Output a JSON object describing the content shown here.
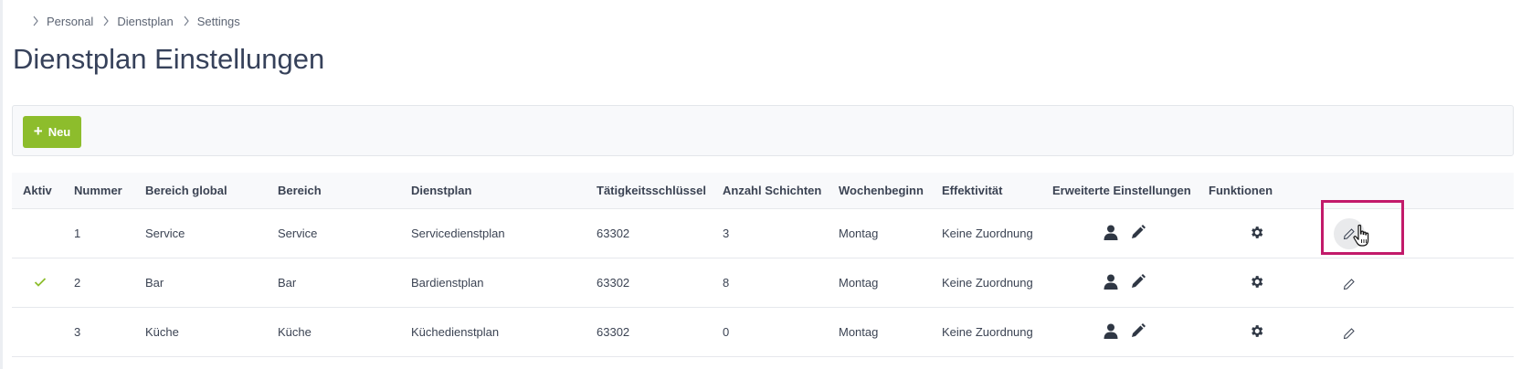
{
  "breadcrumb": [
    "Personal",
    "Dienstplan",
    "Settings"
  ],
  "page": {
    "title": "Dienstplan Einstellungen"
  },
  "toolbar": {
    "new_label": "Neu"
  },
  "table": {
    "columns": [
      "Aktiv",
      "Nummer",
      "Bereich global",
      "Bereich",
      "Dienstplan",
      "Tätigkeitsschlüssel",
      "Anzahl Schichten",
      "Wochenbeginn",
      "Effektivität",
      "Erweiterte Einstellungen",
      "Funktionen"
    ],
    "rows": [
      {
        "active": false,
        "nummer": "1",
        "bereich_global": "Service",
        "bereich": "Service",
        "dienstplan": "Servicedienstplan",
        "schluessel": "63302",
        "schichten": "3",
        "wochenbeginn": "Montag",
        "effektivitaet": "Keine Zuordnung"
      },
      {
        "active": true,
        "nummer": "2",
        "bereich_global": "Bar",
        "bereich": "Bar",
        "dienstplan": "Bardienstplan",
        "schluessel": "63302",
        "schichten": "8",
        "wochenbeginn": "Montag",
        "effektivitaet": "Keine Zuordnung"
      },
      {
        "active": false,
        "nummer": "3",
        "bereich_global": "Küche",
        "bereich": "Küche",
        "dienstplan": "Küchedienstplan",
        "schluessel": "63302",
        "schichten": "0",
        "wochenbeginn": "Montag",
        "effektivitaet": "Keine Zuordnung"
      }
    ]
  },
  "icons": {
    "breadcrumb_separator": "chevron-right-icon",
    "active": "check-icon",
    "extended": [
      "user-icon",
      "pencil-icon"
    ],
    "functions": "gear-icon",
    "row_action": "edit-icon"
  },
  "colors": {
    "accent": "#8dbd2c",
    "title": "#36415a",
    "highlight": "#c21a6a",
    "row_border": "#e6e8ec",
    "toolbar_bg": "#f8f9fb"
  }
}
